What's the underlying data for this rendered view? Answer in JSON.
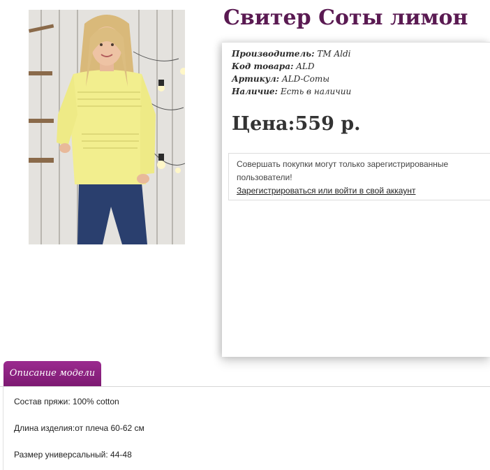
{
  "product": {
    "title": "Свитер Соты лимон",
    "image_alt": "Свитер Соты лимон"
  },
  "meta": {
    "manufacturer_label": "Производитель:",
    "manufacturer_value": "ТМ Aldi",
    "code_label": "Код товара:",
    "code_value": "ALD",
    "article_label": "Артикул:",
    "article_value": "ALD-Соты",
    "availability_label": "Наличие:",
    "availability_value": "Есть в наличии"
  },
  "price": {
    "label": "Цена:",
    "value": "559 р."
  },
  "notice": {
    "text": "Совершать покупки могут только зарегистрированные пользователи!",
    "link": "Зарегистрироваться или войти в свой аккаунт"
  },
  "tabs": [
    {
      "label": "Описание модели",
      "active": true
    }
  ],
  "description": [
    "Состав пряжи: 100% cotton",
    "Длина изделия:от плеча 60-62 см",
    "Размер универсальный: 44-48"
  ],
  "colors": {
    "title": "#5a1a52",
    "tab_bg": "#8b2180",
    "sweater": "#f2ee8e",
    "jeans": "#2a3f6e"
  }
}
